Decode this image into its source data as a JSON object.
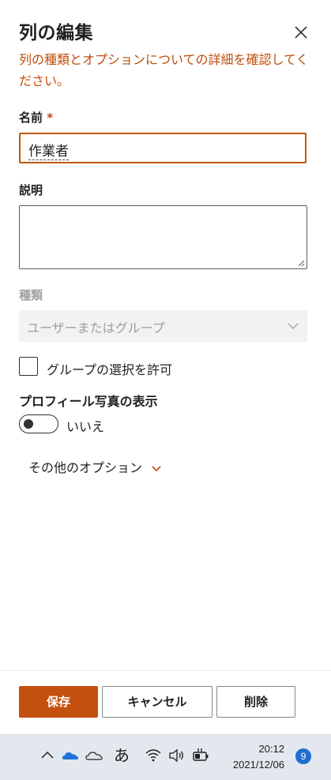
{
  "panel": {
    "title": "列の編集",
    "description": "列の種類とオプションについての詳細を確認してください。",
    "name": {
      "label": "名前",
      "required_mark": "*",
      "value": "作業者"
    },
    "description_field": {
      "label": "説明",
      "value": ""
    },
    "type": {
      "label": "種類",
      "selected": "ユーザーまたはグループ"
    },
    "allow_groups": {
      "label": "グループの選択を許可",
      "checked": false
    },
    "profile_photo": {
      "label": "プロフィール写真の表示",
      "toggle_text": "いいえ",
      "on": false
    },
    "more_options": "その他のオプション"
  },
  "footer": {
    "save": "保存",
    "cancel": "キャンセル",
    "delete": "削除"
  },
  "colors": {
    "accent": "#c4500f",
    "link_text": "#c04d0c",
    "disabled_text": "#a19f9d"
  },
  "taskbar": {
    "ime_mode": "あ",
    "time": "20:12",
    "date": "2021/12/06",
    "notification_count": "9",
    "icons": [
      "chevron-up-icon",
      "onedrive-icon",
      "cloud-icon",
      "wifi-icon",
      "volume-icon",
      "battery-charging-icon"
    ]
  }
}
